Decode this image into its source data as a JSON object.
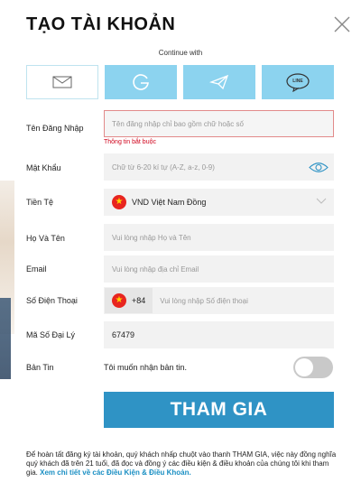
{
  "title": "TẠO TÀI KHOẢN",
  "continue_with": "Continue with",
  "social": [
    "email-icon",
    "google-icon",
    "telegram-icon",
    "line-icon"
  ],
  "line_text": "LINE",
  "form": {
    "username_label": "Tên Đăng Nhập",
    "username_placeholder": "Tên đăng nhập chỉ bao gồm chữ hoặc số",
    "username_error": "Thông tin bắt buộc",
    "password_label": "Mật Khẩu",
    "password_placeholder": "Chữ từ 6-20 kí tự (A-Z, a-z, 0-9)",
    "currency_label": "Tiền Tệ",
    "currency_value": "VND Việt Nam Đồng",
    "fullname_label": "Họ Và Tên",
    "fullname_placeholder": "Vui lòng nhập Họ và Tên",
    "email_label": "Email",
    "email_placeholder": "Vui lòng nhập địa chỉ Email",
    "phone_label": "Số Điện Thoại",
    "phone_code": "+84",
    "phone_placeholder": "Vui lòng nhập Số điện thoại",
    "agent_label": "Mã Số Đại Lý",
    "agent_value": "67479",
    "newsletter_label": "Bản Tin",
    "newsletter_text": "Tôi muốn nhận bản tin.",
    "newsletter_on": false
  },
  "submit_label": "THAM GIA",
  "terms_text": "Để hoàn tất đăng ký tài khoản, quý khách nhấp chuột vào thanh THAM GIA, việc này đồng nghĩa quý khách đã trên 21 tuổi, đã đọc và đồng ý các điều kiện & điều khoản của chúng tôi khi tham gia.",
  "terms_link": "Xem chi tiết về các Điều Kiện & Điều Khoản.",
  "colors": {
    "accent": "#2f93c5",
    "social_bg": "#8cd3ef",
    "error": "#d0021b",
    "flag_red": "#e8251f",
    "flag_star": "#ffd400"
  }
}
